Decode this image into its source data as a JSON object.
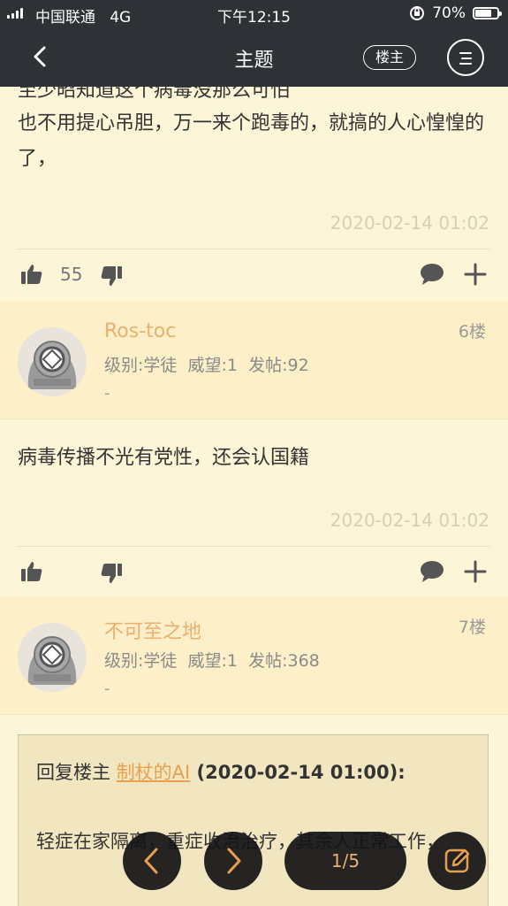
{
  "status_bar": {
    "carrier": "中国联通",
    "network": "4G",
    "time": "下午12:15",
    "battery": "70%"
  },
  "nav": {
    "title": "主题",
    "louzhu_label": "楼主"
  },
  "post_prev": {
    "cut_text": "至少昭知道这个病毒没那么可怕",
    "text": "也不用提心吊胆，万一来个跑毒的，就搞的人心惶惶的了，",
    "timestamp": "2020-02-14 01:02",
    "like_count": "55"
  },
  "floor6": {
    "username": "Ros-toc",
    "floor": "6楼",
    "level": "级别:学徒",
    "prestige": "威望:1",
    "posts": "发帖:92",
    "signature": "-",
    "text": "病毒传播不光有党性，还会认国籍",
    "timestamp": "2020-02-14 01:02"
  },
  "floor7": {
    "username": "不可至之地",
    "floor": "7楼",
    "level": "级别:学徒",
    "prestige": "威望:1",
    "posts": "发帖:368",
    "signature": "-",
    "quote_prefix": "回复楼主 ",
    "quote_user": "制杖的AI",
    "quote_time": " (2020-02-14 01:00):",
    "quote_body": "轻症在家隔离，重症收治治疗，其余人正常工作，"
  },
  "pager": {
    "label": "1/5"
  },
  "colors": {
    "nav_bg": "#2e3236",
    "post_bg": "#fdf5d8",
    "author_bg": "#fdf0c9",
    "username": "#e9b070",
    "quote_link": "#e9a050"
  }
}
